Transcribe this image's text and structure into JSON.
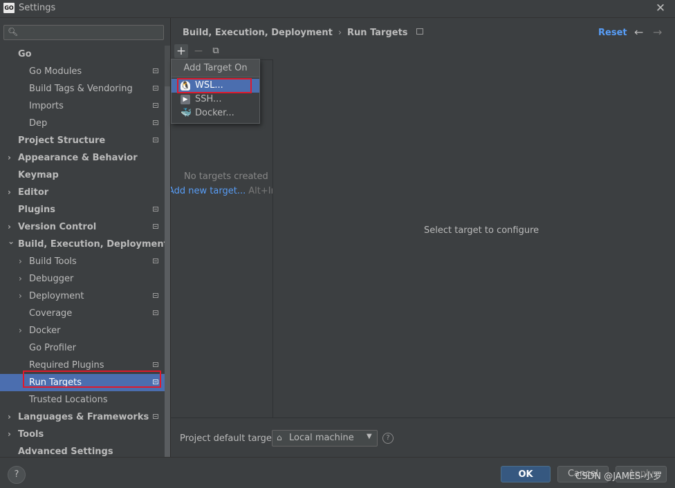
{
  "window": {
    "logo_text": "GO",
    "title": "Settings",
    "close_glyph": "✕"
  },
  "search": {
    "placeholder": "",
    "value": ""
  },
  "sidebar": {
    "items": [
      {
        "label": "Go",
        "level": 0,
        "bold": true,
        "chevron": "none",
        "project": false
      },
      {
        "label": "Go Modules",
        "level": 1,
        "bold": false,
        "chevron": "none",
        "project": true
      },
      {
        "label": "Build Tags & Vendoring",
        "level": 1,
        "bold": false,
        "chevron": "none",
        "project": true
      },
      {
        "label": "Imports",
        "level": 1,
        "bold": false,
        "chevron": "none",
        "project": true
      },
      {
        "label": "Dep",
        "level": 1,
        "bold": false,
        "chevron": "none",
        "project": true
      },
      {
        "label": "Project Structure",
        "level": 0,
        "bold": true,
        "chevron": "none",
        "project": true
      },
      {
        "label": "Appearance & Behavior",
        "level": 0,
        "bold": true,
        "chevron": "collapsed",
        "project": false
      },
      {
        "label": "Keymap",
        "level": 0,
        "bold": true,
        "chevron": "none",
        "project": false
      },
      {
        "label": "Editor",
        "level": 0,
        "bold": true,
        "chevron": "collapsed",
        "project": false
      },
      {
        "label": "Plugins",
        "level": 0,
        "bold": true,
        "chevron": "none",
        "project": true
      },
      {
        "label": "Version Control",
        "level": 0,
        "bold": true,
        "chevron": "collapsed",
        "project": true
      },
      {
        "label": "Build, Execution, Deployment",
        "level": 0,
        "bold": true,
        "chevron": "expanded",
        "project": false
      },
      {
        "label": "Build Tools",
        "level": 1,
        "bold": false,
        "chevron": "collapsed",
        "project": true
      },
      {
        "label": "Debugger",
        "level": 1,
        "bold": false,
        "chevron": "collapsed",
        "project": false
      },
      {
        "label": "Deployment",
        "level": 1,
        "bold": false,
        "chevron": "collapsed",
        "project": true
      },
      {
        "label": "Coverage",
        "level": 1,
        "bold": false,
        "chevron": "none",
        "project": true
      },
      {
        "label": "Docker",
        "level": 1,
        "bold": false,
        "chevron": "collapsed",
        "project": false
      },
      {
        "label": "Go Profiler",
        "level": 1,
        "bold": false,
        "chevron": "none",
        "project": false
      },
      {
        "label": "Required Plugins",
        "level": 1,
        "bold": false,
        "chevron": "none",
        "project": true
      },
      {
        "label": "Run Targets",
        "level": 1,
        "bold": false,
        "chevron": "none",
        "project": true,
        "selected": true
      },
      {
        "label": "Trusted Locations",
        "level": 1,
        "bold": false,
        "chevron": "none",
        "project": false
      },
      {
        "label": "Languages & Frameworks",
        "level": 0,
        "bold": true,
        "chevron": "collapsed",
        "project": true
      },
      {
        "label": "Tools",
        "level": 0,
        "bold": true,
        "chevron": "collapsed",
        "project": false
      },
      {
        "label": "Advanced Settings",
        "level": 0,
        "bold": true,
        "chevron": "none",
        "project": false
      }
    ]
  },
  "header": {
    "breadcrumb_parent": "Build, Execution, Deployment",
    "breadcrumb_sep": "›",
    "breadcrumb_current": "Run Targets",
    "reset_label": "Reset",
    "back_glyph": "←",
    "forward_glyph": "→"
  },
  "toolbar": {
    "add_glyph": "+",
    "remove_glyph": "−",
    "copy_glyph": "⧉"
  },
  "targets": {
    "empty_text": "No targets created",
    "add_link": "Add new target...",
    "add_shortcut": "Alt+Insert",
    "select_hint": "Select target to configure"
  },
  "popup": {
    "header": "Add Target On",
    "items": [
      {
        "label": "WSL...",
        "icon": "linux-tux-icon",
        "glyph": "🐧",
        "active": true
      },
      {
        "label": "SSH...",
        "icon": "ssh-terminal-icon",
        "glyph": "▶",
        "active": false
      },
      {
        "label": "Docker...",
        "icon": "docker-whale-icon",
        "glyph": "🐳",
        "active": false
      }
    ]
  },
  "footer": {
    "default_target_label": "Project default target:",
    "default_target_value": "Local machine",
    "home_glyph": "⌂",
    "arrow_glyph": "▼",
    "help_glyph": "?"
  },
  "buttons": {
    "help": "?",
    "ok": "OK",
    "cancel": "Cancel",
    "apply": "Apply"
  },
  "watermark": "CSDN @JAMES-小罗",
  "colors": {
    "selection": "#4b6eaf",
    "link": "#589df6",
    "highlight_outline": "#e0192b",
    "background": "#3c3f41"
  }
}
